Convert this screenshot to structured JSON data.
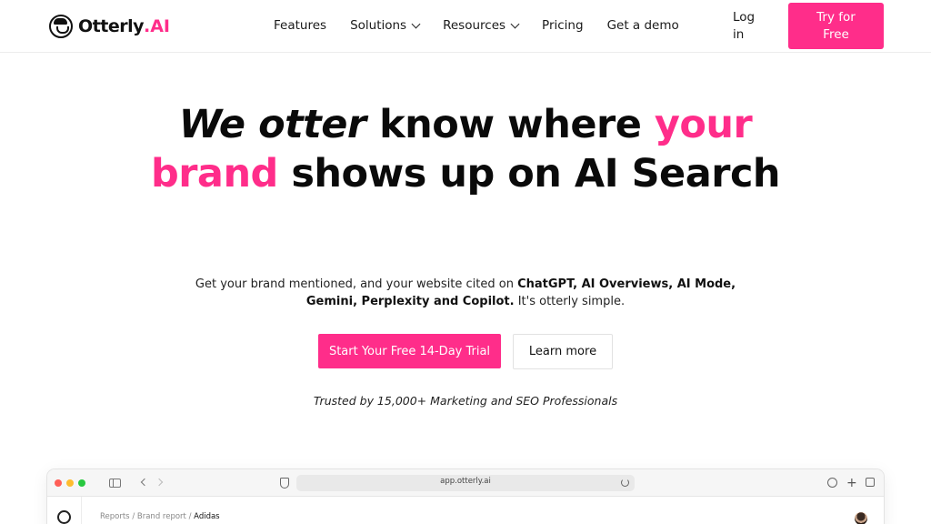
{
  "brand": {
    "name": "Otterly",
    "dot_ai": ".AI",
    "accent": "#ff2d8a"
  },
  "nav": {
    "items": [
      {
        "label": "Features",
        "has_dropdown": false
      },
      {
        "label": "Solutions",
        "has_dropdown": true
      },
      {
        "label": "Resources",
        "has_dropdown": true
      },
      {
        "label": "Pricing",
        "has_dropdown": false
      },
      {
        "label": "Get a demo",
        "has_dropdown": false
      }
    ],
    "login": "Log in",
    "try_free": "Try for Free"
  },
  "hero": {
    "title_part1": "We otter",
    "title_part2": " know where ",
    "title_part3": "your brand",
    "title_part4": " shows up on AI Search",
    "subtitle_part1": "Get your brand mentioned, and your website cited on ",
    "subtitle_bold": "ChatGPT, AI Overviews, AI Mode, Gemini, Perplexity and Copilot.",
    "subtitle_part2": " It's otterly simple.",
    "cta_primary": "Start Your Free 14-Day Trial",
    "cta_secondary": "Learn more",
    "trusted": "Trusted by 15,000+ Marketing and SEO Professionals"
  },
  "browser": {
    "url": "app.otterly.ai",
    "breadcrumb": [
      "Reports",
      "Brand report",
      "Adidas"
    ]
  }
}
